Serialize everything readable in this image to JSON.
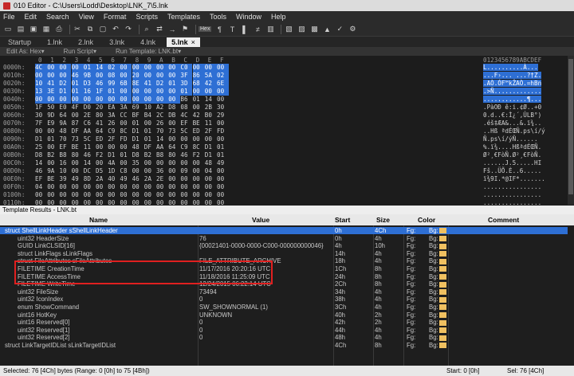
{
  "window": {
    "title": "010 Editor - C:\\Users\\Lodd\\Desktop\\LNK_7\\5.lnk"
  },
  "menu": [
    "File",
    "Edit",
    "Search",
    "View",
    "Format",
    "Scripts",
    "Templates",
    "Tools",
    "Window",
    "Help"
  ],
  "toolbar": {
    "icons": [
      "new-file-icon",
      "open-icon",
      "save-icon",
      "save-all-icon",
      "print-icon",
      "cut-icon",
      "copy-icon",
      "paste-icon",
      "undo-icon",
      "redo-icon",
      "find-icon",
      "replace-icon",
      "goto-icon",
      "bookmark-icon",
      "hex-toggle-icon",
      "paragraph-icon",
      "text-icon",
      "highlight-icon",
      "compare-icon",
      "inspector-icon",
      "template-icon",
      "script-icon",
      "calc-icon",
      "histogram-icon",
      "checksum-icon",
      "settings-icon"
    ],
    "hex_label": "Hex"
  },
  "tabs": [
    {
      "label": "Startup",
      "active": false
    },
    {
      "label": "1.lnk",
      "active": false
    },
    {
      "label": "2.lnk",
      "active": false
    },
    {
      "label": "3.lnk",
      "active": false
    },
    {
      "label": "4.lnk",
      "active": false
    },
    {
      "label": "5.lnk",
      "active": true
    }
  ],
  "tab_close": "×",
  "subbar": [
    "Edit As: Hex▾",
    "Run Script▾",
    "Run Template: LNK.bt▾"
  ],
  "hex": {
    "header": [
      "0",
      "1",
      "2",
      "3",
      "4",
      "5",
      "6",
      "7",
      "8",
      "9",
      "A",
      "B",
      "C",
      "D",
      "E",
      "F"
    ],
    "ascii_header": "0123456789ABCDEF",
    "rows": [
      {
        "off": "0000h:",
        "bytes": [
          "4C",
          "00",
          "00",
          "00",
          "01",
          "14",
          "02",
          "00",
          "00",
          "00",
          "00",
          "00",
          "C0",
          "00",
          "00",
          "00"
        ],
        "ascii": "L..........À...",
        "sel": 16
      },
      {
        "off": "0010h:",
        "bytes": [
          "00",
          "00",
          "00",
          "46",
          "9B",
          "00",
          "08",
          "00",
          "20",
          "00",
          "00",
          "00",
          "3F",
          "86",
          "5A",
          "02"
        ],
        "ascii": "...F›... ...?†Z.",
        "sel": 16
      },
      {
        "off": "0020h:",
        "bytes": [
          "10",
          "41",
          "D2",
          "01",
          "D3",
          "46",
          "99",
          "6B",
          "8E",
          "41",
          "D2",
          "01",
          "3D",
          "68",
          "42",
          "6E"
        ],
        "ascii": ".AÒ.ÓF™kŽAÒ.=hBn",
        "sel": 16
      },
      {
        "off": "0030h:",
        "bytes": [
          "13",
          "3E",
          "D1",
          "01",
          "16",
          "1F",
          "01",
          "00",
          "00",
          "00",
          "00",
          "00",
          "01",
          "00",
          "00",
          "00"
        ],
        "ascii": ".>Ñ.............",
        "sel": 16
      },
      {
        "off": "0040h:",
        "bytes": [
          "00",
          "00",
          "00",
          "00",
          "00",
          "00",
          "00",
          "00",
          "00",
          "00",
          "00",
          "00",
          "B6",
          "01",
          "14",
          "00"
        ],
        "ascii": "............¶...",
        "sel": 12
      },
      {
        "off": "0050h:",
        "bytes": [
          "1F",
          "50",
          "E0",
          "4F",
          "D0",
          "20",
          "EA",
          "3A",
          "69",
          "10",
          "A2",
          "D8",
          "08",
          "00",
          "2B",
          "30"
        ],
        "ascii": ".PàOÐ ê:i.¢Ø..+0",
        "sel": 0
      },
      {
        "off": "0060h:",
        "bytes": [
          "30",
          "9D",
          "64",
          "00",
          "2E",
          "80",
          "3A",
          "CC",
          "BF",
          "B4",
          "2C",
          "DB",
          "4C",
          "42",
          "B0",
          "29"
        ],
        "ascii": "0.d..€:Ì¿´,ÛLB°)",
        "sel": 0
      },
      {
        "off": "0070h:",
        "bytes": [
          "7F",
          "E9",
          "9A",
          "87",
          "C6",
          "41",
          "26",
          "00",
          "01",
          "00",
          "26",
          "00",
          "EF",
          "BE",
          "11",
          "00"
        ],
        "ascii": ".éš‡ÆA&...&.ï¾..",
        "sel": 0
      },
      {
        "off": "0080h:",
        "bytes": [
          "00",
          "00",
          "48",
          "DF",
          "AA",
          "64",
          "C9",
          "8C",
          "D1",
          "01",
          "70",
          "73",
          "5C",
          "ED",
          "2F",
          "FD"
        ],
        "ascii": "..Hß ªdÉŒÑ.ps\\í/ý",
        "sel": 0
      },
      {
        "off": "0090h:",
        "bytes": [
          "D1",
          "01",
          "70",
          "73",
          "5C",
          "ED",
          "2F",
          "FD",
          "D1",
          "01",
          "14",
          "00",
          "00",
          "00",
          "00",
          "00"
        ],
        "ascii": "Ñ.ps\\í/ýÑ......",
        "sel": 0
      },
      {
        "off": "00A0h:",
        "bytes": [
          "25",
          "00",
          "EF",
          "BE",
          "11",
          "00",
          "00",
          "00",
          "48",
          "DF",
          "AA",
          "64",
          "C9",
          "8C",
          "D1",
          "01"
        ],
        "ascii": "%.ï¾....HßªdÉŒÑ.",
        "sel": 0
      },
      {
        "off": "00B0h:",
        "bytes": [
          "D8",
          "B2",
          "B8",
          "80",
          "46",
          "F2",
          "D1",
          "01",
          "D8",
          "B2",
          "B8",
          "80",
          "46",
          "F2",
          "D1",
          "01"
        ],
        "ascii": "Ø²¸€FòÑ.Ø²¸€FòÑ.",
        "sel": 0
      },
      {
        "off": "00C0h:",
        "bytes": [
          "14",
          "00",
          "16",
          "00",
          "14",
          "00",
          "4A",
          "00",
          "35",
          "00",
          "00",
          "00",
          "00",
          "00",
          "48",
          "49"
        ],
        "ascii": "......J.5.....HI",
        "sel": 0
      },
      {
        "off": "00D0h:",
        "bytes": [
          "46",
          "9A",
          "10",
          "00",
          "DC",
          "D5",
          "1D",
          "C8",
          "00",
          "00",
          "36",
          "00",
          "09",
          "00",
          "04",
          "00"
        ],
        "ascii": "Fš..ÜÕ.È..6.....",
        "sel": 0
      },
      {
        "off": "00E0h:",
        "bytes": [
          "EF",
          "BE",
          "39",
          "49",
          "8D",
          "2A",
          "40",
          "49",
          "46",
          "2A",
          "2E",
          "00",
          "00",
          "00",
          "00",
          "00"
        ],
        "ascii": "ï¾9I.*@IF*.......",
        "sel": 0
      },
      {
        "off": "00F0h:",
        "bytes": [
          "04",
          "00",
          "00",
          "00",
          "00",
          "00",
          "00",
          "00",
          "00",
          "00",
          "00",
          "00",
          "00",
          "00",
          "00",
          "00"
        ],
        "ascii": "................",
        "sel": 0
      },
      {
        "off": "0100h:",
        "bytes": [
          "00",
          "00",
          "00",
          "00",
          "00",
          "00",
          "00",
          "00",
          "00",
          "00",
          "00",
          "00",
          "00",
          "00",
          "00",
          "00"
        ],
        "ascii": "................",
        "sel": 0
      },
      {
        "off": "0110h:",
        "bytes": [
          "00",
          "00",
          "00",
          "00",
          "00",
          "00",
          "00",
          "00",
          "00",
          "00",
          "00",
          "00",
          "00",
          "00",
          "00",
          "00"
        ],
        "ascii": "................",
        "sel": 0
      }
    ]
  },
  "template_panel": {
    "title": "Template Results - LNK.bt",
    "headers": {
      "name": "Name",
      "value": "Value",
      "start": "Start",
      "size": "Size",
      "color": "Color",
      "comment": "Comment"
    },
    "rows": [
      {
        "name": "struct ShellLinkHeader sShellLinkHeader",
        "value": "",
        "start": "0h",
        "size": "4Ch",
        "fg": "Fg:",
        "bg": "Bg:",
        "indent": 1,
        "sel": true
      },
      {
        "name": "uint32 HeaderSize",
        "value": "76",
        "start": "0h",
        "size": "4h",
        "fg": "Fg:",
        "bg": "Bg:",
        "indent": 2,
        "sel": false
      },
      {
        "name": "GUID LinkCLSID[16]",
        "value": "{00021401-0000-0000-C000-000000000046}",
        "start": "4h",
        "size": "10h",
        "fg": "Fg:",
        "bg": "Bg:",
        "indent": 2,
        "sel": false
      },
      {
        "name": "struct LinkFlags sLinkFlags",
        "value": "",
        "start": "14h",
        "size": "4h",
        "fg": "Fg:",
        "bg": "Bg:",
        "indent": 2,
        "sel": false
      },
      {
        "name": "struct FileAttributes sFileAttributes",
        "value": "FILE_ATTRIBUTE_ARCHIVE",
        "start": "18h",
        "size": "4h",
        "fg": "Fg:",
        "bg": "Bg:",
        "indent": 2,
        "sel": false
      },
      {
        "name": "FILETIME CreationTime",
        "value": "11/17/2016 20:20:16 UTC",
        "start": "1Ch",
        "size": "8h",
        "fg": "Fg:",
        "bg": "Bg:",
        "indent": 2,
        "sel": false
      },
      {
        "name": "FILETIME AccessTime",
        "value": "11/18/2016 11:25:09 UTC",
        "start": "24h",
        "size": "8h",
        "fg": "Fg:",
        "bg": "Bg:",
        "indent": 2,
        "sel": false
      },
      {
        "name": "FILETIME WriteTime",
        "value": "12/24/2015 06:22:14 UTC",
        "start": "2Ch",
        "size": "8h",
        "fg": "Fg:",
        "bg": "Bg:",
        "indent": 2,
        "sel": false
      },
      {
        "name": "uint32 FileSize",
        "value": "73494",
        "start": "34h",
        "size": "4h",
        "fg": "Fg:",
        "bg": "Bg:",
        "indent": 2,
        "sel": false
      },
      {
        "name": "uint32 IconIndex",
        "value": "0",
        "start": "38h",
        "size": "4h",
        "fg": "Fg:",
        "bg": "Bg:",
        "indent": 2,
        "sel": false
      },
      {
        "name": "enum ShowCommand",
        "value": "SW_SHOWNORMAL (1)",
        "start": "3Ch",
        "size": "4h",
        "fg": "Fg:",
        "bg": "Bg:",
        "indent": 2,
        "sel": false
      },
      {
        "name": "uint16 HotKey",
        "value": "UNKNOWN",
        "start": "40h",
        "size": "2h",
        "fg": "Fg:",
        "bg": "Bg:",
        "indent": 2,
        "sel": false
      },
      {
        "name": "uint16 Reserved[0]",
        "value": "0",
        "start": "42h",
        "size": "2h",
        "fg": "Fg:",
        "bg": "Bg:",
        "indent": 2,
        "sel": false
      },
      {
        "name": "uint32 Reserved[1]",
        "value": "0",
        "start": "44h",
        "size": "4h",
        "fg": "Fg:",
        "bg": "Bg:",
        "indent": 2,
        "sel": false
      },
      {
        "name": "uint32 Reserved[2]",
        "value": "0",
        "start": "48h",
        "size": "4h",
        "fg": "Fg:",
        "bg": "Bg:",
        "indent": 2,
        "sel": false
      },
      {
        "name": "struct LinkTargetIDList sLinkTargetIDList",
        "value": "",
        "start": "4Ch",
        "size": "8h",
        "fg": "Fg:",
        "bg": "Bg:",
        "indent": 1,
        "sel": false
      }
    ]
  },
  "status": {
    "left": "Selected: 76 [4Ch] bytes (Range: 0 [0h] to 75 [4Bh])",
    "start": "Start: 0 [0h]",
    "sel": "Sel: 76 [4Ch]"
  },
  "colors": {
    "selection": "#2e6fd4",
    "highlight_box": "#e02020",
    "swatch": "#f0c060"
  }
}
